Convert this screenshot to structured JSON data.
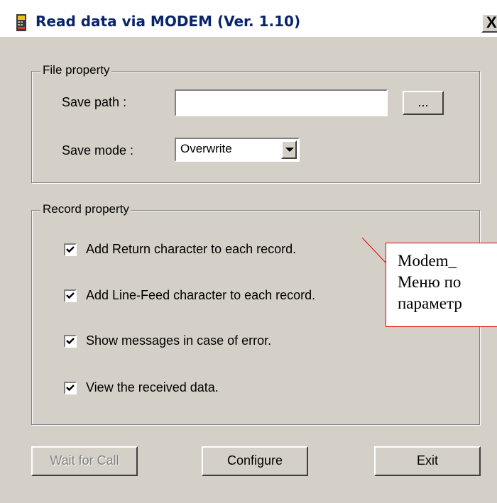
{
  "window": {
    "title": "Read data via MODEM (Ver. 1.10)",
    "close_label": "X"
  },
  "file_property": {
    "legend": "File property",
    "save_path_label": "Save path :",
    "save_path_value": "",
    "browse_label": "...",
    "save_mode_label": "Save mode :",
    "save_mode_value": "Overwrite"
  },
  "record_property": {
    "legend": "Record property",
    "options": [
      {
        "label": "Add Return character to each record.",
        "checked": true
      },
      {
        "label": "Add Line-Feed character to each record.",
        "checked": true
      },
      {
        "label": "Show messages in case of error.",
        "checked": true
      },
      {
        "label": "View the received data.",
        "checked": true
      }
    ]
  },
  "buttons": {
    "wait_label": "Wait for Call",
    "wait_enabled": false,
    "configure_label": "Configure",
    "exit_label": "Exit"
  },
  "callout": {
    "line1": "Modem_",
    "line2": "Меню по",
    "line3": "параметр"
  },
  "colors": {
    "face": "#d4d0c8",
    "title_text": "#0a246a",
    "callout_border": "#e00000"
  }
}
